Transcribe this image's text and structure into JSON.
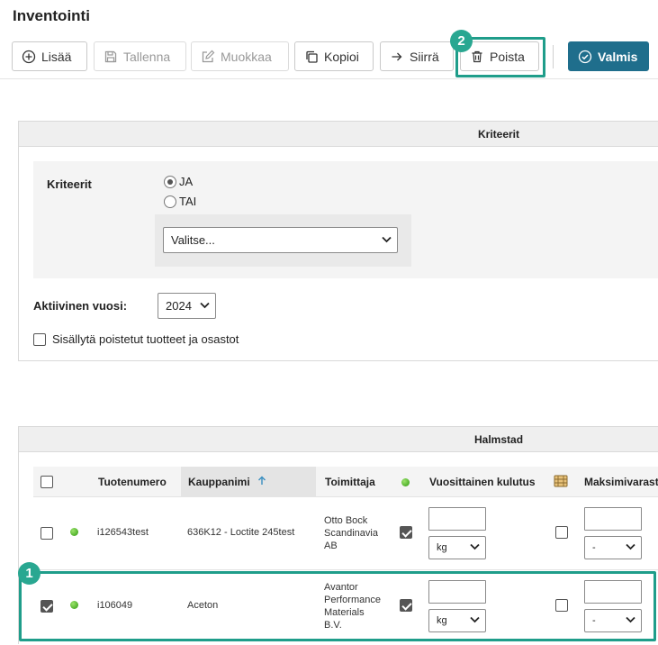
{
  "page": {
    "title": "Inventointi"
  },
  "toolbar": {
    "add": "Lisää",
    "save": "Tallenna",
    "edit": "Muokkaa",
    "copy": "Kopioi",
    "move": "Siirrä",
    "delete": "Poista",
    "done": "Valmis"
  },
  "criteria_panel": {
    "header": "Kriteerit",
    "label": "Kriteerit",
    "radio_and": "JA",
    "radio_or": "TAI",
    "selected_radio": "JA",
    "select_value": "Valitse...",
    "active_year_label": "Aktiivinen vuosi:",
    "active_year_value": "2024",
    "include_deleted_label": "Sisällytä poistetut tuotteet ja osastot"
  },
  "table_panel": {
    "header": "Halmstad",
    "columns": {
      "product_number": "Tuotenumero",
      "trade_name": "Kauppanimi",
      "supplier": "Toimittaja",
      "yearly_usage": "Vuosittainen kulutus",
      "max_stock": "Maksimivarast"
    },
    "rows": [
      {
        "product_number": "i126543test",
        "trade_name": "636K12 - Loctite 245test",
        "supplier_lines": [
          "Otto Bock",
          "Scandinavia",
          "AB"
        ],
        "unit": "kg",
        "max_unit": "-",
        "selected": false
      },
      {
        "product_number": "i106049",
        "trade_name": "Aceton",
        "supplier_lines": [
          "Avantor",
          "Performance",
          "Materials",
          "B.V."
        ],
        "unit": "kg",
        "max_unit": "-",
        "selected": true
      }
    ]
  },
  "annotations": {
    "badge1": "1",
    "badge2": "2"
  },
  "colors": {
    "primary": "#1f6e8c",
    "highlight": "#1f9d8a",
    "status_green": "#2f9a10"
  }
}
